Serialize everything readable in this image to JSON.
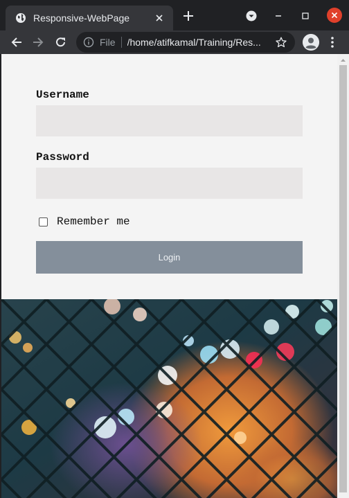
{
  "browser": {
    "tab_title": "Responsive-WebPage",
    "address_scheme": "File",
    "address_path": "/home/atifkamal/Training/Res..."
  },
  "form": {
    "username_label": "Username",
    "password_label": "Password",
    "remember_label": "Remember me",
    "remember_checked": false,
    "login_label": "Login"
  },
  "icons": {
    "tab": "globe-icon",
    "close": "close-icon",
    "new_tab": "plus-icon",
    "back": "arrow-back-icon",
    "forward": "arrow-forward-icon",
    "reload": "reload-icon",
    "info": "info-icon",
    "bookmark": "star-icon",
    "profile": "profile-icon",
    "menu": "kebab-menu-icon"
  },
  "colors": {
    "chrome_dark": "#202124",
    "toolbar": "#35363a",
    "page_bg": "#f4f4f4",
    "input_bg": "#e8e6e6",
    "button_bg": "#848f9b",
    "close_red": "#e0402b"
  }
}
